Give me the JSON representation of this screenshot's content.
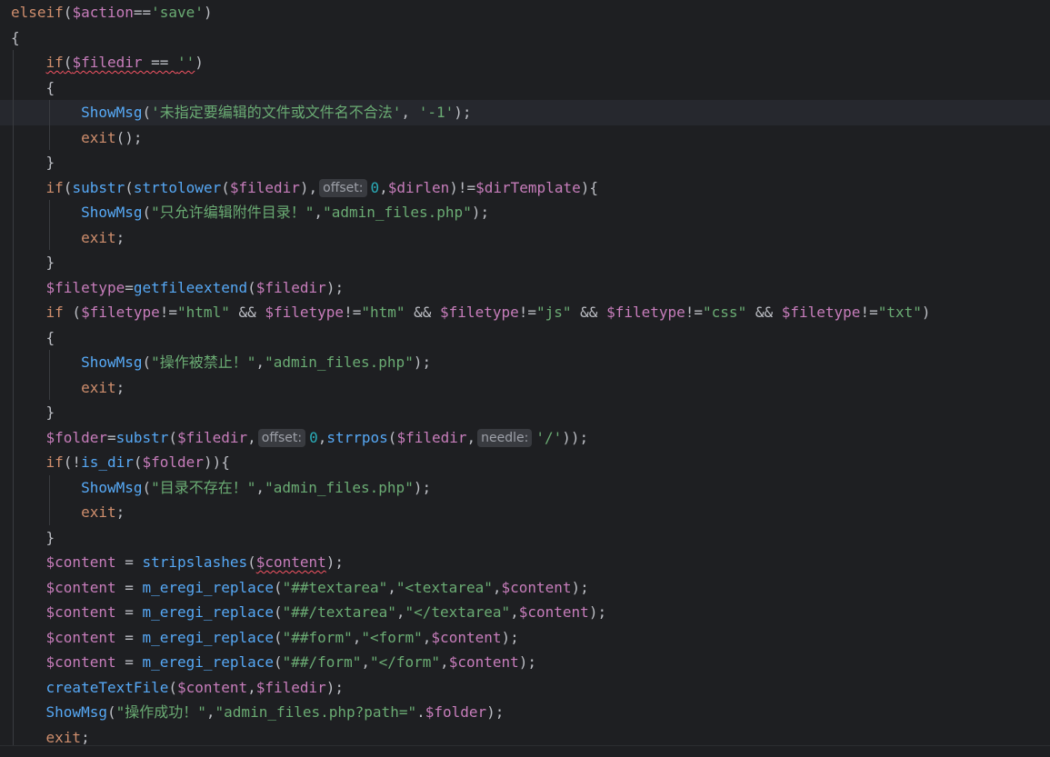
{
  "editor": {
    "language": "php",
    "highlighted_line": 4,
    "lines": [
      [
        {
          "t": "elseif",
          "c": "kw"
        },
        {
          "t": "("
        },
        {
          "t": "$action",
          "c": "var"
        },
        {
          "t": "=="
        },
        {
          "t": "'save'",
          "c": "str"
        },
        {
          "t": ")"
        }
      ],
      [
        {
          "t": "{"
        }
      ],
      [
        {
          "t": "    "
        },
        {
          "t": "if",
          "c": "kw sq"
        },
        {
          "t": "(",
          "c": "sq"
        },
        {
          "t": "$filedir",
          "c": "var sq"
        },
        {
          "t": " == ",
          "c": "sq"
        },
        {
          "t": "''",
          "c": "str sq"
        },
        {
          "t": ")"
        }
      ],
      [
        {
          "t": "    {"
        }
      ],
      [
        {
          "t": "        "
        },
        {
          "t": "ShowMsg",
          "c": "fn"
        },
        {
          "t": "("
        },
        {
          "t": "'未指定要编辑的文件或文件名不合法'",
          "c": "str"
        },
        {
          "t": ", "
        },
        {
          "t": "'-1'",
          "c": "str"
        },
        {
          "t": ");"
        }
      ],
      [
        {
          "t": "        "
        },
        {
          "t": "exit",
          "c": "kw"
        },
        {
          "t": "();"
        }
      ],
      [
        {
          "t": "    }"
        }
      ],
      [
        {
          "t": "    "
        },
        {
          "t": "if",
          "c": "kw"
        },
        {
          "t": "("
        },
        {
          "t": "substr",
          "c": "fn2"
        },
        {
          "t": "("
        },
        {
          "t": "strtolower",
          "c": "fn2"
        },
        {
          "t": "("
        },
        {
          "t": "$filedir",
          "c": "var"
        },
        {
          "t": "),"
        },
        {
          "t": "offset:",
          "c": "hint"
        },
        {
          "t": "0",
          "c": "num"
        },
        {
          "t": ","
        },
        {
          "t": "$dirlen",
          "c": "var"
        },
        {
          "t": ")!="
        },
        {
          "t": "$dirTemplate",
          "c": "var"
        },
        {
          "t": "){"
        }
      ],
      [
        {
          "t": "        "
        },
        {
          "t": "ShowMsg",
          "c": "fn"
        },
        {
          "t": "("
        },
        {
          "t": "\"只允许编辑附件目录！\"",
          "c": "str"
        },
        {
          "t": ","
        },
        {
          "t": "\"admin_files.php\"",
          "c": "str"
        },
        {
          "t": ");"
        }
      ],
      [
        {
          "t": "        "
        },
        {
          "t": "exit",
          "c": "kw"
        },
        {
          "t": ";"
        }
      ],
      [
        {
          "t": "    }"
        }
      ],
      [
        {
          "t": "    "
        },
        {
          "t": "$filetype",
          "c": "var"
        },
        {
          "t": "="
        },
        {
          "t": "getfileextend",
          "c": "fn2"
        },
        {
          "t": "("
        },
        {
          "t": "$filedir",
          "c": "var"
        },
        {
          "t": ");"
        }
      ],
      [
        {
          "t": "    "
        },
        {
          "t": "if",
          "c": "kw"
        },
        {
          "t": " ("
        },
        {
          "t": "$filetype",
          "c": "var"
        },
        {
          "t": "!="
        },
        {
          "t": "\"html\"",
          "c": "str"
        },
        {
          "t": " && "
        },
        {
          "t": "$filetype",
          "c": "var"
        },
        {
          "t": "!="
        },
        {
          "t": "\"htm\"",
          "c": "str"
        },
        {
          "t": " && "
        },
        {
          "t": "$filetype",
          "c": "var"
        },
        {
          "t": "!="
        },
        {
          "t": "\"js\"",
          "c": "str"
        },
        {
          "t": " && "
        },
        {
          "t": "$filetype",
          "c": "var"
        },
        {
          "t": "!="
        },
        {
          "t": "\"css\"",
          "c": "str"
        },
        {
          "t": " && "
        },
        {
          "t": "$filetype",
          "c": "var"
        },
        {
          "t": "!="
        },
        {
          "t": "\"txt\"",
          "c": "str"
        },
        {
          "t": ")"
        }
      ],
      [
        {
          "t": "    {"
        }
      ],
      [
        {
          "t": "        "
        },
        {
          "t": "ShowMsg",
          "c": "fn"
        },
        {
          "t": "("
        },
        {
          "t": "\"操作被禁止！\"",
          "c": "str"
        },
        {
          "t": ","
        },
        {
          "t": "\"admin_files.php\"",
          "c": "str"
        },
        {
          "t": ");"
        }
      ],
      [
        {
          "t": "        "
        },
        {
          "t": "exit",
          "c": "kw"
        },
        {
          "t": ";"
        }
      ],
      [
        {
          "t": "    }"
        }
      ],
      [
        {
          "t": "    "
        },
        {
          "t": "$folder",
          "c": "var"
        },
        {
          "t": "="
        },
        {
          "t": "substr",
          "c": "fn2"
        },
        {
          "t": "("
        },
        {
          "t": "$filedir",
          "c": "var"
        },
        {
          "t": ","
        },
        {
          "t": "offset:",
          "c": "hint"
        },
        {
          "t": "0",
          "c": "num"
        },
        {
          "t": ","
        },
        {
          "t": "strrpos",
          "c": "fn2"
        },
        {
          "t": "("
        },
        {
          "t": "$filedir",
          "c": "var"
        },
        {
          "t": ","
        },
        {
          "t": "needle:",
          "c": "hint"
        },
        {
          "t": "'/'",
          "c": "str"
        },
        {
          "t": "));"
        }
      ],
      [
        {
          "t": "    "
        },
        {
          "t": "if",
          "c": "kw"
        },
        {
          "t": "(!"
        },
        {
          "t": "is_dir",
          "c": "fn2"
        },
        {
          "t": "("
        },
        {
          "t": "$folder",
          "c": "var"
        },
        {
          "t": ")){"
        }
      ],
      [
        {
          "t": "        "
        },
        {
          "t": "ShowMsg",
          "c": "fn"
        },
        {
          "t": "("
        },
        {
          "t": "\"目录不存在！\"",
          "c": "str"
        },
        {
          "t": ","
        },
        {
          "t": "\"admin_files.php\"",
          "c": "str"
        },
        {
          "t": ");"
        }
      ],
      [
        {
          "t": "        "
        },
        {
          "t": "exit",
          "c": "kw"
        },
        {
          "t": ";"
        }
      ],
      [
        {
          "t": "    }"
        }
      ],
      [
        {
          "t": "    "
        },
        {
          "t": "$content",
          "c": "var"
        },
        {
          "t": " = "
        },
        {
          "t": "stripslashes",
          "c": "fn2"
        },
        {
          "t": "("
        },
        {
          "t": "$content",
          "c": "var sq"
        },
        {
          "t": ");"
        }
      ],
      [
        {
          "t": "    "
        },
        {
          "t": "$content",
          "c": "var"
        },
        {
          "t": " = "
        },
        {
          "t": "m_eregi_replace",
          "c": "fn2"
        },
        {
          "t": "("
        },
        {
          "t": "\"##textarea\"",
          "c": "str"
        },
        {
          "t": ","
        },
        {
          "t": "\"<textarea\"",
          "c": "str"
        },
        {
          "t": ","
        },
        {
          "t": "$content",
          "c": "var"
        },
        {
          "t": ");"
        }
      ],
      [
        {
          "t": "    "
        },
        {
          "t": "$content",
          "c": "var"
        },
        {
          "t": " = "
        },
        {
          "t": "m_eregi_replace",
          "c": "fn2"
        },
        {
          "t": "("
        },
        {
          "t": "\"##/textarea\"",
          "c": "str"
        },
        {
          "t": ","
        },
        {
          "t": "\"</textarea\"",
          "c": "str"
        },
        {
          "t": ","
        },
        {
          "t": "$content",
          "c": "var"
        },
        {
          "t": ");"
        }
      ],
      [
        {
          "t": "    "
        },
        {
          "t": "$content",
          "c": "var"
        },
        {
          "t": " = "
        },
        {
          "t": "m_eregi_replace",
          "c": "fn2"
        },
        {
          "t": "("
        },
        {
          "t": "\"##form\"",
          "c": "str"
        },
        {
          "t": ","
        },
        {
          "t": "\"<form\"",
          "c": "str"
        },
        {
          "t": ","
        },
        {
          "t": "$content",
          "c": "var"
        },
        {
          "t": ");"
        }
      ],
      [
        {
          "t": "    "
        },
        {
          "t": "$content",
          "c": "var"
        },
        {
          "t": " = "
        },
        {
          "t": "m_eregi_replace",
          "c": "fn2"
        },
        {
          "t": "("
        },
        {
          "t": "\"##/form\"",
          "c": "str"
        },
        {
          "t": ","
        },
        {
          "t": "\"</form\"",
          "c": "str"
        },
        {
          "t": ","
        },
        {
          "t": "$content",
          "c": "var"
        },
        {
          "t": ");"
        }
      ],
      [
        {
          "t": "    "
        },
        {
          "t": "createTextFile",
          "c": "fn2"
        },
        {
          "t": "("
        },
        {
          "t": "$content",
          "c": "var"
        },
        {
          "t": ","
        },
        {
          "t": "$filedir",
          "c": "var"
        },
        {
          "t": ");"
        }
      ],
      [
        {
          "t": "    "
        },
        {
          "t": "ShowMsg",
          "c": "fn2"
        },
        {
          "t": "("
        },
        {
          "t": "\"操作成功！\"",
          "c": "str"
        },
        {
          "t": ","
        },
        {
          "t": "\"admin_files.php?path=\"",
          "c": "str"
        },
        {
          "t": "."
        },
        {
          "t": "$folder",
          "c": "var"
        },
        {
          "t": ");"
        }
      ],
      [
        {
          "t": "    "
        },
        {
          "t": "exit",
          "c": "kw"
        },
        {
          "t": ";"
        }
      ]
    ]
  },
  "colors": {
    "background": "#1e1f22",
    "keyword": "#cf8e6d",
    "variable": "#c77dbb",
    "string": "#6aab73",
    "function": "#57aaf7",
    "number": "#2aacb8",
    "hint_bg": "#393b40"
  }
}
